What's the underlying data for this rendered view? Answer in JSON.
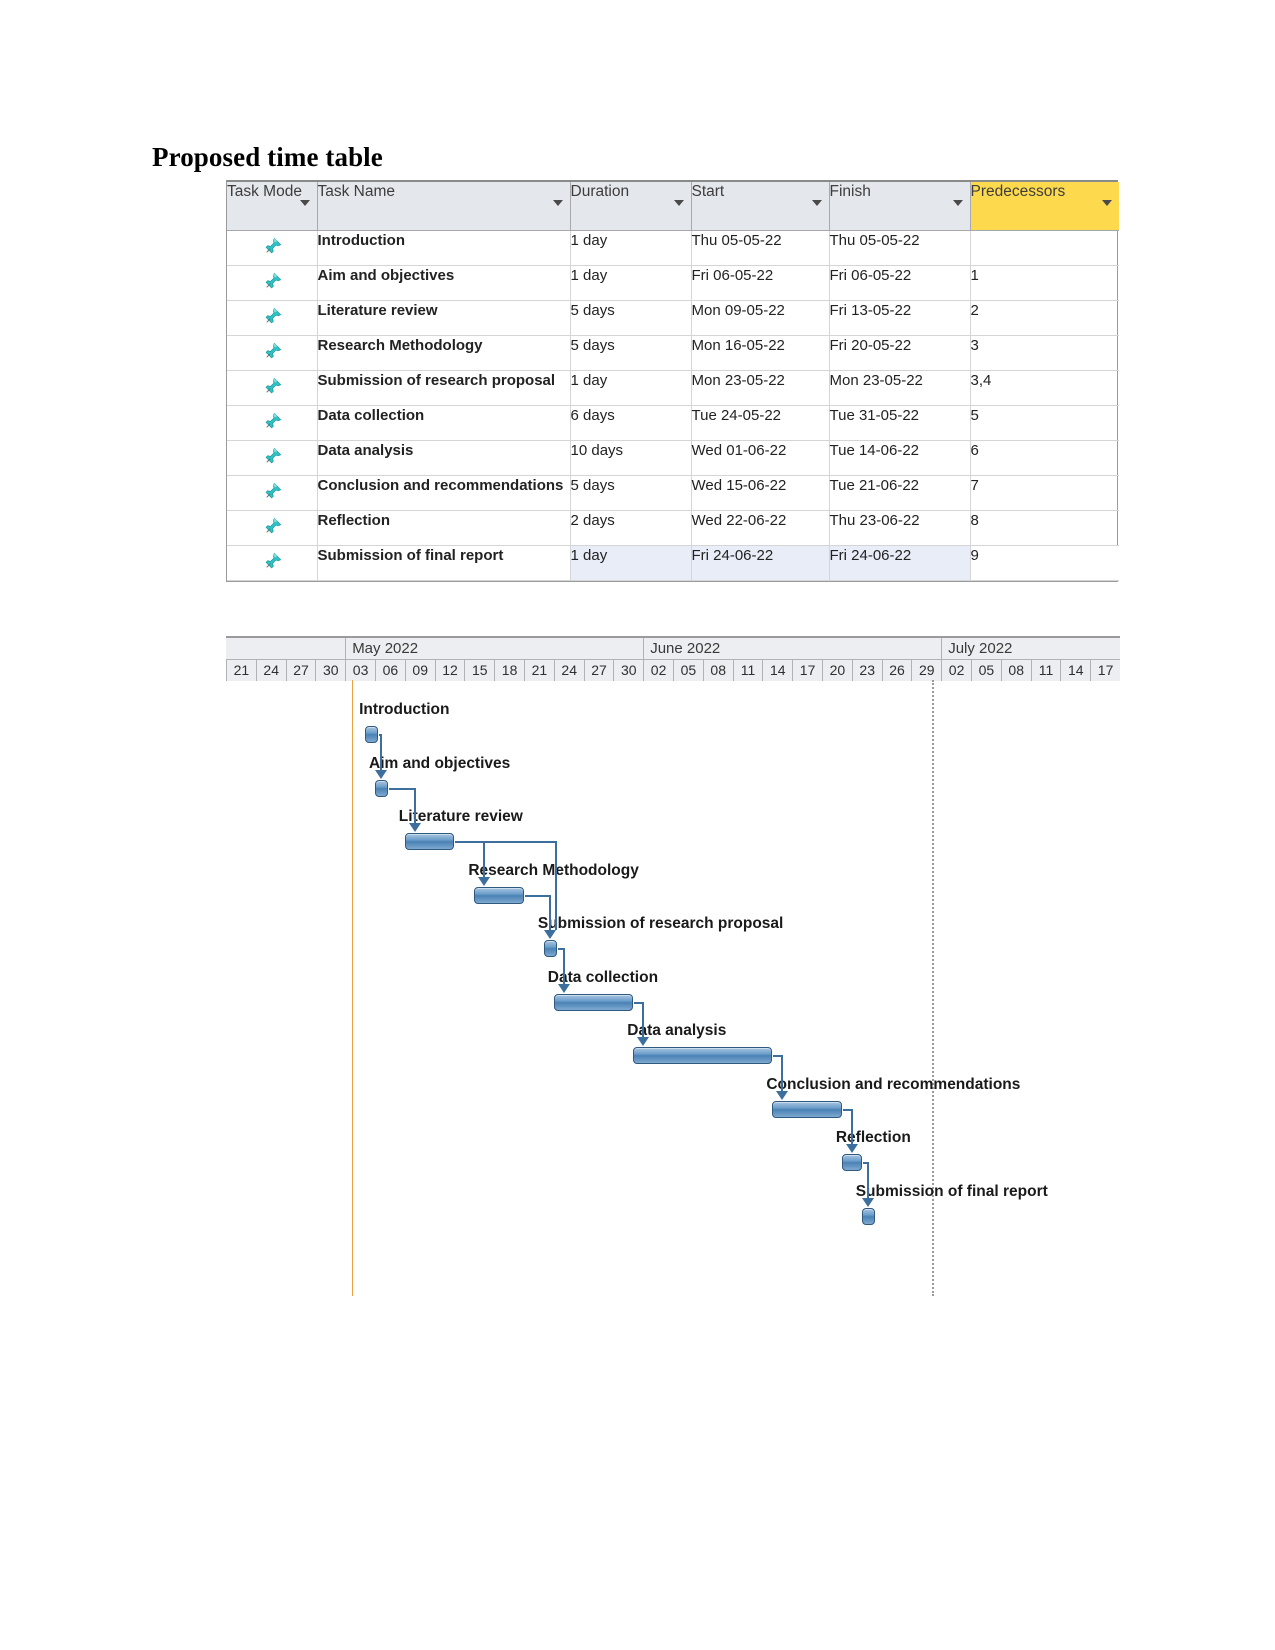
{
  "page": {
    "title": "Proposed time table"
  },
  "table": {
    "columns": [
      {
        "label": "Task Mode",
        "has_filter": true,
        "highlight": false
      },
      {
        "label": "Task Name",
        "has_filter": true,
        "highlight": false
      },
      {
        "label": "Duration",
        "has_filter": true,
        "highlight": false
      },
      {
        "label": "Start",
        "has_filter": true,
        "highlight": false
      },
      {
        "label": "Finish",
        "has_filter": true,
        "highlight": false
      },
      {
        "label": "Predecessors",
        "has_filter": true,
        "highlight": true
      }
    ],
    "header_highlight_color": "#fdd94e",
    "mode_icon": "pushpin-icon",
    "rows": [
      {
        "mode": "manual",
        "name": "Introduction",
        "duration": "1 day",
        "start": "Thu 05-05-22",
        "finish": "Thu 05-05-22",
        "predecessors": ""
      },
      {
        "mode": "manual",
        "name": "Aim and objectives",
        "duration": "1 day",
        "start": "Fri 06-05-22",
        "finish": "Fri 06-05-22",
        "predecessors": "1"
      },
      {
        "mode": "manual",
        "name": "Literature review",
        "duration": "5 days",
        "start": "Mon 09-05-22",
        "finish": "Fri 13-05-22",
        "predecessors": "2"
      },
      {
        "mode": "manual",
        "name": "Research Methodology",
        "duration": "5 days",
        "start": "Mon 16-05-22",
        "finish": "Fri 20-05-22",
        "predecessors": "3"
      },
      {
        "mode": "manual",
        "name": "Submission of research proposal",
        "duration": "1 day",
        "start": "Mon 23-05-22",
        "finish": "Mon 23-05-22",
        "predecessors": "3,4"
      },
      {
        "mode": "manual",
        "name": "Data collection",
        "duration": "6 days",
        "start": "Tue 24-05-22",
        "finish": "Tue 31-05-22",
        "predecessors": "5"
      },
      {
        "mode": "manual",
        "name": "Data analysis",
        "duration": "10 days",
        "start": "Wed 01-06-22",
        "finish": "Tue 14-06-22",
        "predecessors": "6"
      },
      {
        "mode": "manual",
        "name": "Conclusion and recommendations",
        "duration": "5 days",
        "start": "Wed 15-06-22",
        "finish": "Tue 21-06-22",
        "predecessors": "7"
      },
      {
        "mode": "manual",
        "name": "Reflection",
        "duration": "2 days",
        "start": "Wed 22-06-22",
        "finish": "Thu 23-06-22",
        "predecessors": "8"
      },
      {
        "mode": "manual",
        "name": "Submission of final report",
        "duration": "1 day",
        "start": "Fri 24-06-22",
        "finish": "Fri 24-06-22",
        "predecessors": "9",
        "selected": true
      }
    ]
  },
  "chart_data": {
    "type": "bar",
    "subtype": "gantt",
    "title": "Proposed time table",
    "xlabel": "",
    "ylabel": "",
    "grid": false,
    "legend": "none",
    "timeline": {
      "months": [
        "May 2022",
        "June 2022",
        "July 2022"
      ],
      "day_ticks": [
        "21",
        "24",
        "27",
        "30",
        "03",
        "06",
        "09",
        "12",
        "15",
        "18",
        "21",
        "24",
        "27",
        "30",
        "02",
        "05",
        "08",
        "11",
        "14",
        "17",
        "20",
        "23",
        "26",
        "29",
        "02",
        "05",
        "08",
        "11",
        "14",
        "17"
      ],
      "tick_interval_days": 3,
      "axis_start": "2022-04-21",
      "axis_end": "2022-07-19"
    },
    "markers": [
      {
        "name": "today-line",
        "color": "#e8a33d",
        "position_tick_index": 4
      },
      {
        "name": "status-line",
        "color": "#9a9a9a",
        "style": "dotted",
        "position_tick_index": 23
      }
    ],
    "tasks": [
      {
        "label": "Introduction",
        "start": "2022-05-05",
        "finish": "2022-05-05",
        "duration_days": 1,
        "milestone": true,
        "predecessors": []
      },
      {
        "label": "Aim and objectives",
        "start": "2022-05-06",
        "finish": "2022-05-06",
        "duration_days": 1,
        "milestone": true,
        "predecessors": [
          "Introduction"
        ]
      },
      {
        "label": "Literature review",
        "start": "2022-05-09",
        "finish": "2022-05-13",
        "duration_days": 5,
        "milestone": false,
        "predecessors": [
          "Aim and objectives"
        ]
      },
      {
        "label": "Research Methodology",
        "start": "2022-05-16",
        "finish": "2022-05-20",
        "duration_days": 5,
        "milestone": false,
        "predecessors": [
          "Literature review"
        ]
      },
      {
        "label": "Submission of research proposal",
        "start": "2022-05-23",
        "finish": "2022-05-23",
        "duration_days": 1,
        "milestone": true,
        "predecessors": [
          "Literature review",
          "Research Methodology"
        ]
      },
      {
        "label": "Data collection",
        "start": "2022-05-24",
        "finish": "2022-05-31",
        "duration_days": 6,
        "milestone": false,
        "predecessors": [
          "Submission of research proposal"
        ]
      },
      {
        "label": "Data analysis",
        "start": "2022-06-01",
        "finish": "2022-06-14",
        "duration_days": 10,
        "milestone": false,
        "predecessors": [
          "Data collection"
        ]
      },
      {
        "label": "Conclusion and recommendations",
        "start": "2022-06-15",
        "finish": "2022-06-21",
        "duration_days": 5,
        "milestone": false,
        "predecessors": [
          "Data analysis"
        ]
      },
      {
        "label": "Reflection",
        "start": "2022-06-22",
        "finish": "2022-06-23",
        "duration_days": 2,
        "milestone": false,
        "predecessors": [
          "Conclusion and recommendations"
        ]
      },
      {
        "label": "Submission of final report",
        "start": "2022-06-24",
        "finish": "2022-06-24",
        "duration_days": 1,
        "milestone": true,
        "predecessors": [
          "Reflection"
        ]
      }
    ],
    "bar_color": "#4a82b5",
    "bar_border_color": "#30597f"
  }
}
